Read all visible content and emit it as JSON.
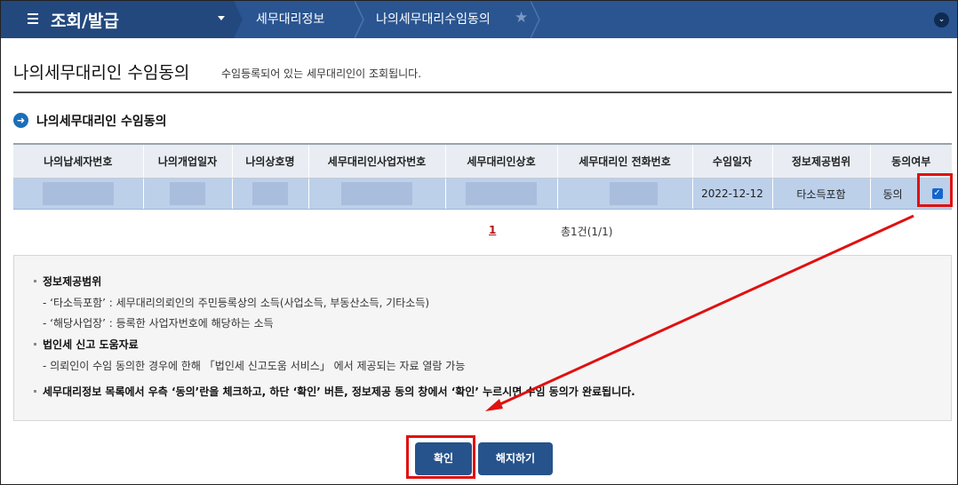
{
  "nav": {
    "menu_title": "조회/발급",
    "crumbs": [
      "세무대리정보",
      "나의세무대리수임동의"
    ]
  },
  "page": {
    "title": "나의세무대리인 수임동의",
    "subtitle": "수임등록되어 있는 세무대리인이 조회됩니다.",
    "section_title": "나의세무대리인 수임동의"
  },
  "table": {
    "headers": [
      "나의납세자번호",
      "나의개업일자",
      "나의상호명",
      "세무대리인사업자번호",
      "세무대리인상호",
      "세무대리인 전화번호",
      "수임일자",
      "정보제공범위",
      "동의여부"
    ],
    "row": {
      "date": "2022-12-12",
      "scope": "타소득포함",
      "consent": "동의",
      "checked": true
    }
  },
  "pagination": {
    "current_page": "1",
    "total": "총1건(1/1)"
  },
  "info": {
    "h1": "정보제공범위",
    "l1": "- ‘타소득포함’ : 세무대리의뢰인의 주민등록상의 소득(사업소득, 부동산소득, 기타소득)",
    "l2": "- ‘해당사업장’ : 등록한 사업자번호에 해당하는 소득",
    "h2": "법인세 신고 도움자료",
    "l3": "- 의뢰인이 수임 동의한 경우에 한해 「법인세 신고도움 서비스」 에서 제공되는 자료 열람 가능",
    "h3": "세무대리정보 목록에서 우측 ‘동의’란을 체크하고, 하단 ‘확인’ 버튼, 정보제공 동의 창에서 ‘확인’ 누르시면 수임 동의가 완료됩니다."
  },
  "buttons": {
    "confirm": "확인",
    "cancel": "해지하기"
  },
  "colors": {
    "nav_bg": "#2a5591",
    "button": "#26538c",
    "highlight": "#e01010"
  }
}
